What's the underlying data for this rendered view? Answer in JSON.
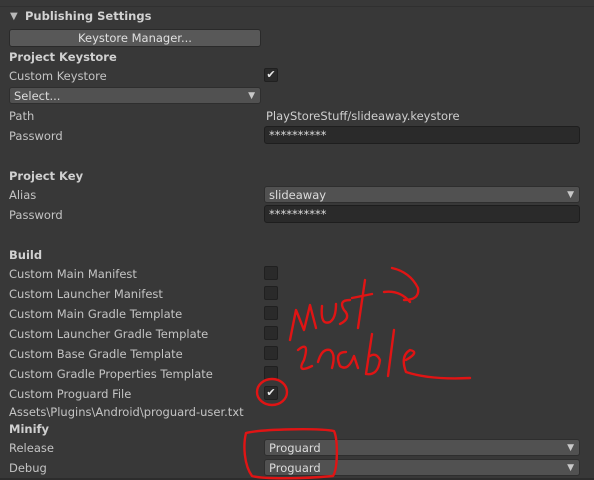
{
  "panel": {
    "title": "Publishing Settings",
    "collapse_icon": "triangle-down-icon"
  },
  "keystore_manager_button": "Keystore Manager...",
  "project_keystore": {
    "heading": "Project Keystore",
    "custom_keystore_label": "Custom Keystore",
    "custom_keystore_checked": true,
    "select_dropdown": "Select...",
    "path_label": "Path",
    "path_value": "PlayStoreStuff/slideaway.keystore",
    "password_label": "Password",
    "password_value": "**********"
  },
  "project_key": {
    "heading": "Project Key",
    "alias_label": "Alias",
    "alias_value": "slideaway",
    "password_label": "Password",
    "password_value": "**********"
  },
  "build": {
    "heading": "Build",
    "options": [
      {
        "label": "Custom Main Manifest",
        "checked": false
      },
      {
        "label": "Custom Launcher Manifest",
        "checked": false
      },
      {
        "label": "Custom Main Gradle Template",
        "checked": false
      },
      {
        "label": "Custom Launcher Gradle Template",
        "checked": false
      },
      {
        "label": "Custom Base Gradle Template",
        "checked": false
      },
      {
        "label": "Custom Gradle Properties Template",
        "checked": false
      },
      {
        "label": "Custom Proguard File",
        "checked": true
      }
    ],
    "proguard_path": "Assets\\Plugins\\Android\\proguard-user.txt"
  },
  "minify": {
    "heading": "Minify",
    "release_label": "Release",
    "release_value": "Proguard",
    "debug_label": "Debug",
    "debug_value": "Proguard"
  },
  "annotation": {
    "text": "must enable",
    "color": "#e01414"
  },
  "check_glyph": "✔",
  "dropdown_arrow_glyph": "▼"
}
